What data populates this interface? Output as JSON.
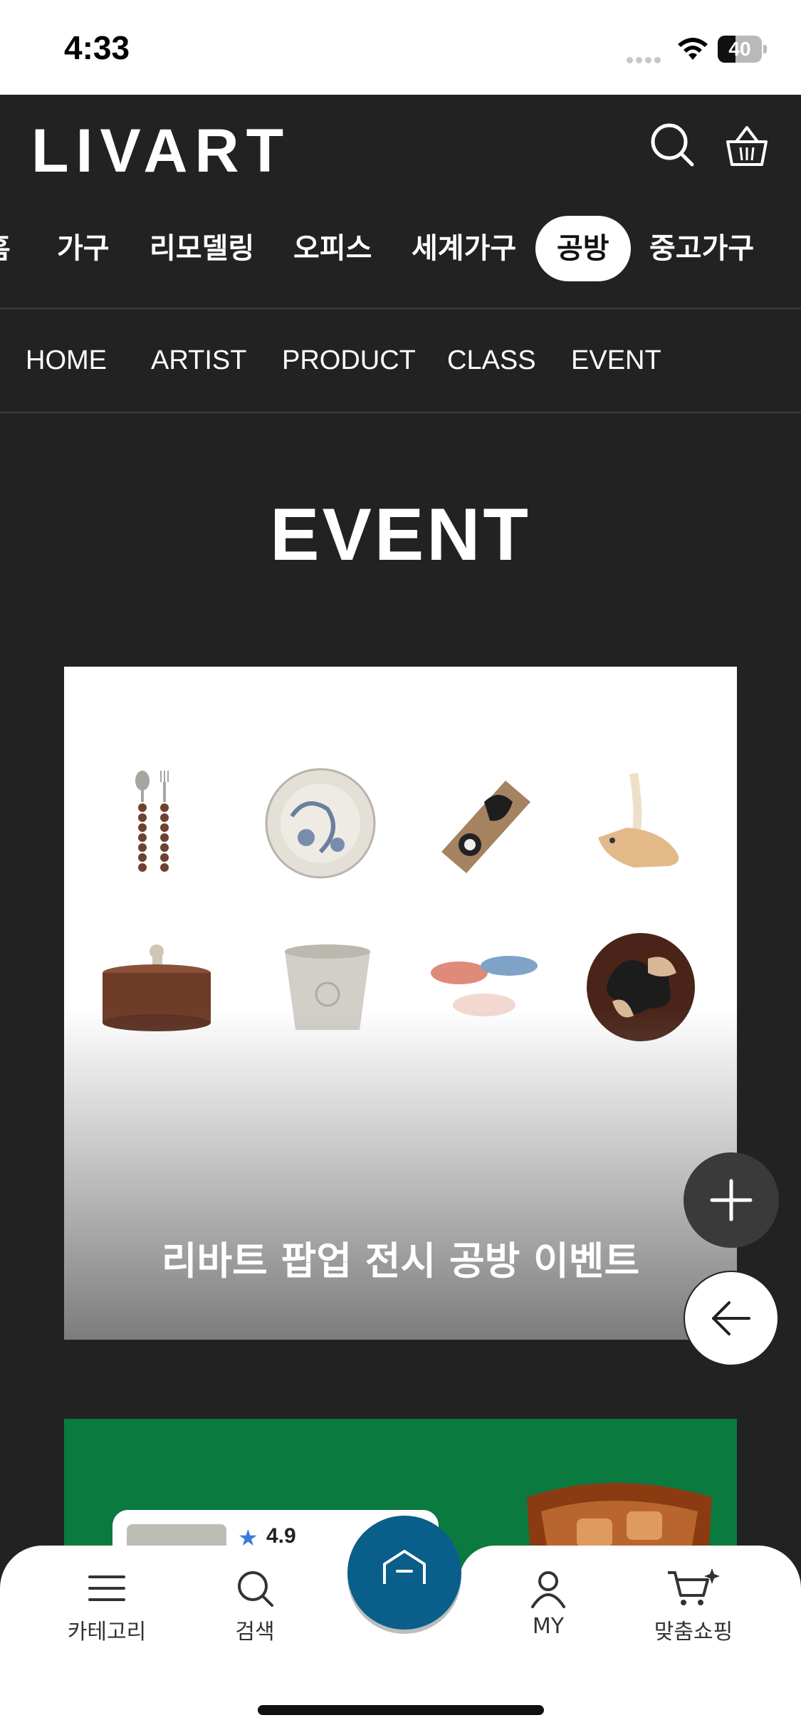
{
  "status_bar": {
    "time": "4:33",
    "battery": "40",
    "battery_level": 0.4
  },
  "header": {
    "logo": "LIVART",
    "categories": [
      "홈",
      "가구",
      "리모델링",
      "오피스",
      "세계가구",
      "공방",
      "중고가구"
    ],
    "active_category": "공방"
  },
  "sub_nav": {
    "items": [
      "HOME",
      "ARTIST",
      "PRODUCT",
      "CLASS",
      "EVENT"
    ]
  },
  "section": {
    "title": "EVENT"
  },
  "events": [
    {
      "title": "리바트 팝업 전시 공방 이벤트"
    },
    {
      "title": "",
      "review_rating": "4.9",
      "background": "#0a7a3f"
    }
  ],
  "bottom_nav": {
    "items": [
      {
        "label": "카테고리",
        "icon": "menu-icon"
      },
      {
        "label": "검색",
        "icon": "search-icon"
      },
      {
        "label": "",
        "icon": "home-icon"
      },
      {
        "label": "MY",
        "icon": "person-icon"
      },
      {
        "label": "맞춤쇼핑",
        "icon": "cart-sparkle-icon"
      }
    ]
  },
  "colors": {
    "background": "#222222",
    "home_button": "#0a5f8a",
    "text": "#ffffff"
  }
}
